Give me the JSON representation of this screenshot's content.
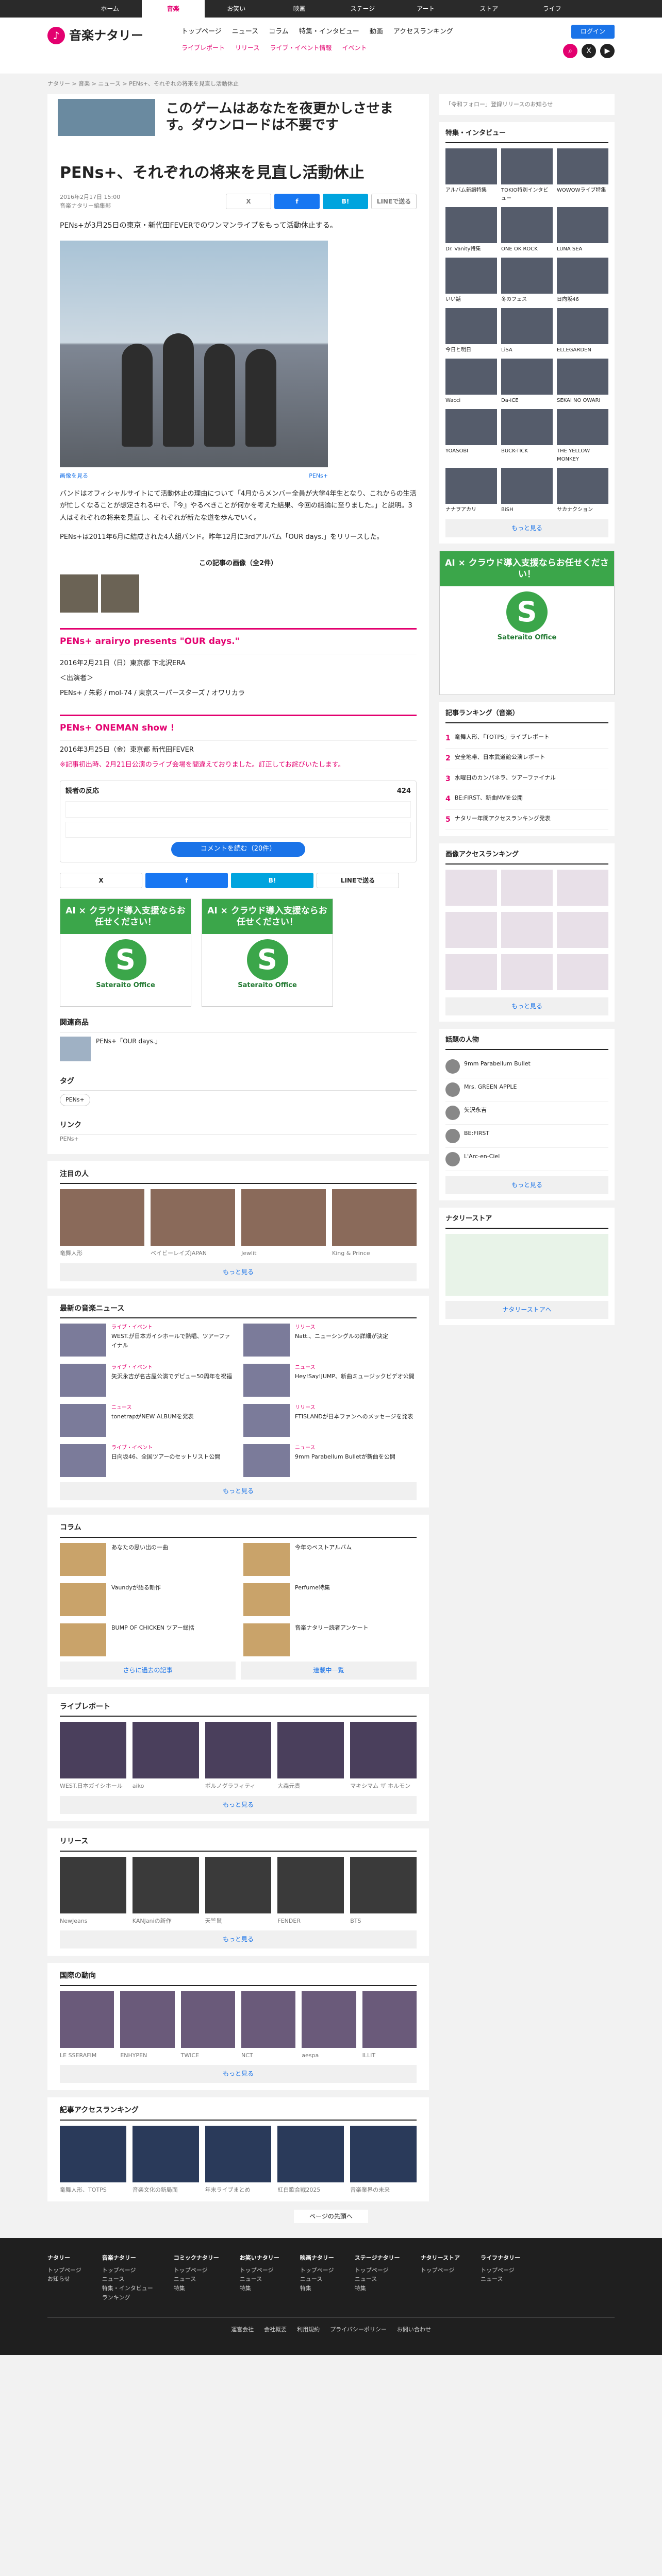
{
  "topnav": {
    "tabs": [
      "ホーム",
      "音楽",
      "お笑い",
      "映画",
      "ステージ",
      "アート",
      "ストア",
      "ライフ"
    ]
  },
  "header": {
    "logo": "音楽ナタリー",
    "menu": [
      "トップページ",
      "ニュース",
      "コラム",
      "特集・インタビュー",
      "動画",
      "アクセスランキング"
    ],
    "sub": [
      "ライブレポート",
      "リリース",
      "ライブ・イベント情報",
      "イベント"
    ],
    "login": "ログイン"
  },
  "crumb": "ナタリー > 音楽 > ニュース > PENs+、それぞれの将来を見直し活動休止",
  "topad": {
    "text": "このゲームはあなたを夜更かしさせます。ダウンロードは不要です"
  },
  "article": {
    "title": "PENs+、それぞれの将来を見直し活動休止",
    "date": "2016年2月17日 15:00",
    "dept": "音楽ナタリー編集部",
    "count": "424",
    "lead": "PENs+が3月25日の東京・新代田FEVERでのワンマンライブをもって活動休止する。",
    "photo_link": "画像を見る",
    "photo_caption": "PENs+",
    "p1": "バンドはオフィシャルサイトにて活動休止の理由について「4月からメンバー全員が大学4年生となり、これからの生活が忙しくなることが想定される中で、『今』やるべきことが何かを考えた結果、今回の結論に至りました。」と説明。3人はそれぞれの将来を見直し、それぞれが新たな道を歩んでいく。",
    "p2": "PENs+は2011年6月に結成された4人組バンド。昨年12月に3rdアルバム「OUR days.」をリリースした。",
    "images_h": "この記事の画像（全2件）"
  },
  "event1": {
    "title": "PENs+ arairyo presents \"OUR days.\"",
    "l1": "2016年2月21日（日）東京都 下北沢ERA",
    "l2": "＜出演者＞",
    "l3": "PENs+ / 朱彩 / mol-74 / 東京スーパースターズ / オワリカラ"
  },
  "event2": {
    "title": "PENs+ ONEMAN show !",
    "l1": "2016年3月25日（金）東京都 新代田FEVER",
    "note": "※記事初出時、2月21日公演のライブ会場を間違えておりました。訂正してお詫びいたします。"
  },
  "comment": {
    "h": "読者の反応",
    "count": "424",
    "btn": "コメントを読む（20件）"
  },
  "share": {
    "x": "X",
    "fb": "f",
    "hb": "B!",
    "line": "LINEで送る"
  },
  "ads": {
    "band": "AI × クラウド導入支援ならお任せください！",
    "s": "S",
    "name": "Sateraito Office"
  },
  "related": {
    "h": "関連商品",
    "item": "PENs+「OUR days.」",
    "tag_h": "タグ",
    "tag": "PENs+",
    "link_h": "リンク",
    "link": "PENs+"
  },
  "popular": {
    "h": "注目の人",
    "items": [
      "竜舞人形",
      "ベイビーレイズJAPAN",
      "Jewlit",
      "King & Prince"
    ],
    "more": "もっと見る"
  },
  "latest": {
    "h": "最新の音楽ニュース",
    "items": [
      {
        "cat": "ライブ・イベント",
        "t": "WEST.が日本ガイシホールで熱唱、ツアーファイナル"
      },
      {
        "cat": "リリース",
        "t": "Natt.、ニューシングルの詳細が決定"
      },
      {
        "cat": "ライブ・イベント",
        "t": "矢沢永吉が名古屋公演でデビュー50周年を祝福"
      },
      {
        "cat": "ニュース",
        "t": "Hey!Say!JUMP、新曲ミュージックビデオ公開"
      },
      {
        "cat": "ニュース",
        "t": "tonetrapがNEW ALBUMを発表"
      },
      {
        "cat": "リリース",
        "t": "FTISLANDが日本ファンへのメッセージを発表"
      },
      {
        "cat": "ライブ・イベント",
        "t": "日向坂46、全国ツアーのセットリスト公開"
      },
      {
        "cat": "ニュース",
        "t": "9mm Parabellum Bulletが新曲を公開"
      }
    ],
    "more": "もっと見る"
  },
  "columns": {
    "h": "コラム",
    "items": [
      "あなたの思い出の一曲",
      "今年のベストアルバム",
      "Vaundyが語る新作",
      "Perfume特集",
      "BUMP OF CHICKEN ツアー総括",
      "音楽ナタリー読者アンケート"
    ],
    "more1": "さらに過去の記事",
    "more2": "連載中一覧"
  },
  "livereport": {
    "h": "ライブレポート",
    "items": [
      "WEST.日本ガイシホール",
      "aiko",
      "ポルノグラフィティ",
      "大森元貴",
      "マキシマム ザ ホルモン"
    ],
    "more": "もっと見る"
  },
  "release": {
    "h": "リリース",
    "items": [
      "NewJeans",
      "KANJaniの新作",
      "天竺鼠",
      "FENDER",
      "BTS"
    ],
    "more": "もっと見る"
  },
  "overseas": {
    "h": "国際の動向",
    "items": [
      "LE SSERAFIM",
      "ENHYPEN",
      "TWICE",
      "NCT",
      "aespa",
      "ILLIT"
    ],
    "more": "もっと見る"
  },
  "ranking": {
    "h": "記事アクセスランキング",
    "items": [
      "竜舞人形、TOTPS",
      "音楽文化の新局面",
      "年末ライブまとめ",
      "紅白歌合戦2025",
      "音楽業界の未来"
    ]
  },
  "sidebar": {
    "follow": "「令和フォロー」登録リリースのお知らせ",
    "feature_h": "特集・インタビュー",
    "feature_items": [
      "アルバム新譜特集",
      "TOKIO特別インタビュー",
      "WOWOWライブ特集",
      "Dr. Vanity特集",
      "ONE OK ROCK",
      "LUNA SEA",
      "いい話",
      "冬のフェス",
      "日向坂46",
      "今日と明日",
      "LiSA",
      "ELLEGARDEN",
      "Wacci",
      "Da-iCE",
      "SEKAI NO OWARI",
      "YOASOBI",
      "BUCK-TICK",
      "THE YELLOW MONKEY",
      "ナナヲアカリ",
      "BiSH",
      "サカナクション"
    ],
    "feature_more": "もっと見る",
    "rank_h": "記事ランキング（音楽）",
    "rank_items": [
      "竜舞人形、「TOTPS」ライブレポート",
      "安全地帯、日本武道館公演レポート",
      "水曜日のカンパネラ、ツアーファイナル",
      "BE:FIRST、新曲MVを公開",
      "ナタリー年間アクセスランキング発表"
    ],
    "img_rank_h": "画像アクセスランキング",
    "img_rank_more": "もっと見る",
    "artist_h": "話題の人物",
    "artists": [
      "9mm Parabellum Bullet",
      "Mrs. GREEN APPLE",
      "矢沢永吉",
      "BE:FIRST",
      "L'Arc-en-Ciel"
    ],
    "artist_more": "もっと見る",
    "map_h": "ナタリーストア",
    "map_more": "ナタリーストアへ"
  },
  "pagetop": "ページの先頭へ",
  "footer": {
    "cols": [
      {
        "h": "ナタリー",
        "items": [
          "トップページ",
          "お知らせ"
        ]
      },
      {
        "h": "音楽ナタリー",
        "items": [
          "トップページ",
          "ニュース",
          "特集・インタビュー",
          "ランキング"
        ]
      },
      {
        "h": "コミックナタリー",
        "items": [
          "トップページ",
          "ニュース",
          "特集"
        ]
      },
      {
        "h": "お笑いナタリー",
        "items": [
          "トップページ",
          "ニュース",
          "特集"
        ]
      },
      {
        "h": "映画ナタリー",
        "items": [
          "トップページ",
          "ニュース",
          "特集"
        ]
      },
      {
        "h": "ステージナタリー",
        "items": [
          "トップページ",
          "ニュース",
          "特集"
        ]
      },
      {
        "h": "ナタリーストア",
        "items": [
          "トップページ"
        ]
      },
      {
        "h": "ライフナタリー",
        "items": [
          "トップページ",
          "ニュース"
        ]
      }
    ],
    "bottom": [
      "運営会社",
      "会社概要",
      "利用規約",
      "プライバシーポリシー",
      "お問い合わせ"
    ]
  }
}
